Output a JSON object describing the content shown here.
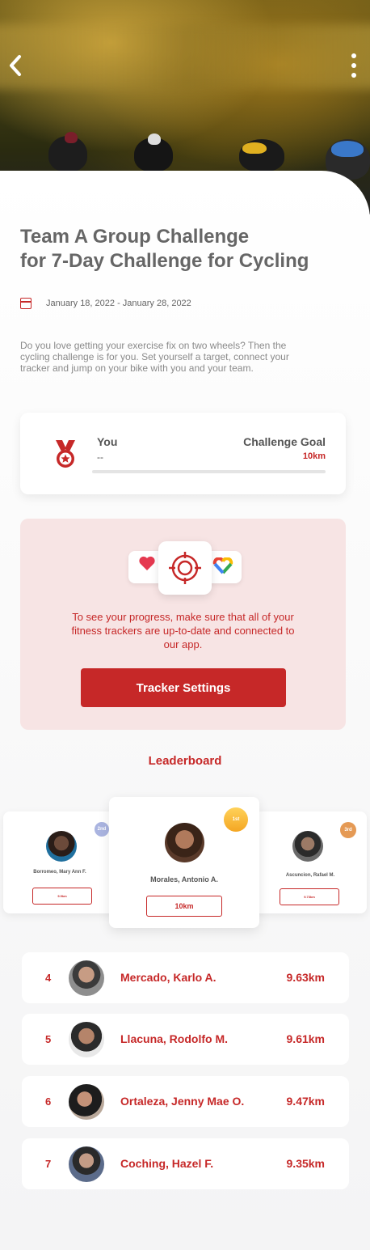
{
  "header": {
    "back_icon": "chevron-left-icon",
    "more_icon": "more-vertical-icon"
  },
  "challenge": {
    "title_line1": "Team A Group Challenge",
    "title_line2": "for 7-Day Challenge for Cycling",
    "date_range": "January 18, 2022 - January 28, 2022",
    "description": "Do you love getting your exercise fix on two wheels? Then the cycling challenge is for you. Set yourself a target, connect your tracker and jump on your bike with you and your team."
  },
  "goal_card": {
    "you_label": "You",
    "you_value": "--",
    "goal_label": "Challenge Goal",
    "goal_value": "10km"
  },
  "tracker": {
    "message": "To see your progress, make sure that all of your fitness trackers are up-to-date and connected to our app.",
    "button_label": "Tracker Settings"
  },
  "leaderboard": {
    "title": "Leaderboard",
    "podium": [
      {
        "rank": "1st",
        "name": "Morales, Antonio A.",
        "distance": "10km"
      },
      {
        "rank": "2nd",
        "name": "Borromeo, Mary Ann F.",
        "distance": "9.9km"
      },
      {
        "rank": "3rd",
        "name": "Ascuncion, Rafael M.",
        "distance": "9.73km"
      }
    ],
    "rows": [
      {
        "rank": "4",
        "name": "Mercado, Karlo A.",
        "distance": "9.63km"
      },
      {
        "rank": "5",
        "name": "Llacuna, Rodolfo M.",
        "distance": "9.61km"
      },
      {
        "rank": "6",
        "name": "Ortaleza, Jenny Mae O.",
        "distance": "9.47km"
      },
      {
        "rank": "7",
        "name": "Coching, Hazel F.",
        "distance": "9.35km"
      }
    ]
  },
  "colors": {
    "accent": "#c62828",
    "tracker_bg": "#f7e4e4",
    "gold": "#f4a623",
    "silver": "#aab4e0",
    "bronze": "#e59a55"
  }
}
